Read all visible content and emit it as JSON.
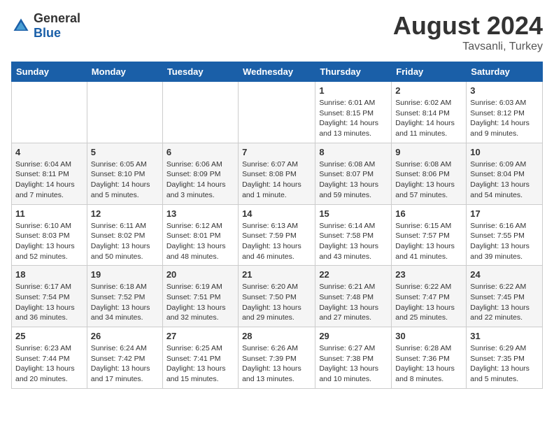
{
  "logo": {
    "text_general": "General",
    "text_blue": "Blue"
  },
  "title": "August 2024",
  "subtitle": "Tavsanli, Turkey",
  "days_of_week": [
    "Sunday",
    "Monday",
    "Tuesday",
    "Wednesday",
    "Thursday",
    "Friday",
    "Saturday"
  ],
  "weeks": [
    [
      {
        "day": "",
        "info": ""
      },
      {
        "day": "",
        "info": ""
      },
      {
        "day": "",
        "info": ""
      },
      {
        "day": "",
        "info": ""
      },
      {
        "day": "1",
        "info": "Sunrise: 6:01 AM\nSunset: 8:15 PM\nDaylight: 14 hours\nand 13 minutes."
      },
      {
        "day": "2",
        "info": "Sunrise: 6:02 AM\nSunset: 8:14 PM\nDaylight: 14 hours\nand 11 minutes."
      },
      {
        "day": "3",
        "info": "Sunrise: 6:03 AM\nSunset: 8:12 PM\nDaylight: 14 hours\nand 9 minutes."
      }
    ],
    [
      {
        "day": "4",
        "info": "Sunrise: 6:04 AM\nSunset: 8:11 PM\nDaylight: 14 hours\nand 7 minutes."
      },
      {
        "day": "5",
        "info": "Sunrise: 6:05 AM\nSunset: 8:10 PM\nDaylight: 14 hours\nand 5 minutes."
      },
      {
        "day": "6",
        "info": "Sunrise: 6:06 AM\nSunset: 8:09 PM\nDaylight: 14 hours\nand 3 minutes."
      },
      {
        "day": "7",
        "info": "Sunrise: 6:07 AM\nSunset: 8:08 PM\nDaylight: 14 hours\nand 1 minute."
      },
      {
        "day": "8",
        "info": "Sunrise: 6:08 AM\nSunset: 8:07 PM\nDaylight: 13 hours\nand 59 minutes."
      },
      {
        "day": "9",
        "info": "Sunrise: 6:08 AM\nSunset: 8:06 PM\nDaylight: 13 hours\nand 57 minutes."
      },
      {
        "day": "10",
        "info": "Sunrise: 6:09 AM\nSunset: 8:04 PM\nDaylight: 13 hours\nand 54 minutes."
      }
    ],
    [
      {
        "day": "11",
        "info": "Sunrise: 6:10 AM\nSunset: 8:03 PM\nDaylight: 13 hours\nand 52 minutes."
      },
      {
        "day": "12",
        "info": "Sunrise: 6:11 AM\nSunset: 8:02 PM\nDaylight: 13 hours\nand 50 minutes."
      },
      {
        "day": "13",
        "info": "Sunrise: 6:12 AM\nSunset: 8:01 PM\nDaylight: 13 hours\nand 48 minutes."
      },
      {
        "day": "14",
        "info": "Sunrise: 6:13 AM\nSunset: 7:59 PM\nDaylight: 13 hours\nand 46 minutes."
      },
      {
        "day": "15",
        "info": "Sunrise: 6:14 AM\nSunset: 7:58 PM\nDaylight: 13 hours\nand 43 minutes."
      },
      {
        "day": "16",
        "info": "Sunrise: 6:15 AM\nSunset: 7:57 PM\nDaylight: 13 hours\nand 41 minutes."
      },
      {
        "day": "17",
        "info": "Sunrise: 6:16 AM\nSunset: 7:55 PM\nDaylight: 13 hours\nand 39 minutes."
      }
    ],
    [
      {
        "day": "18",
        "info": "Sunrise: 6:17 AM\nSunset: 7:54 PM\nDaylight: 13 hours\nand 36 minutes."
      },
      {
        "day": "19",
        "info": "Sunrise: 6:18 AM\nSunset: 7:52 PM\nDaylight: 13 hours\nand 34 minutes."
      },
      {
        "day": "20",
        "info": "Sunrise: 6:19 AM\nSunset: 7:51 PM\nDaylight: 13 hours\nand 32 minutes."
      },
      {
        "day": "21",
        "info": "Sunrise: 6:20 AM\nSunset: 7:50 PM\nDaylight: 13 hours\nand 29 minutes."
      },
      {
        "day": "22",
        "info": "Sunrise: 6:21 AM\nSunset: 7:48 PM\nDaylight: 13 hours\nand 27 minutes."
      },
      {
        "day": "23",
        "info": "Sunrise: 6:22 AM\nSunset: 7:47 PM\nDaylight: 13 hours\nand 25 minutes."
      },
      {
        "day": "24",
        "info": "Sunrise: 6:22 AM\nSunset: 7:45 PM\nDaylight: 13 hours\nand 22 minutes."
      }
    ],
    [
      {
        "day": "25",
        "info": "Sunrise: 6:23 AM\nSunset: 7:44 PM\nDaylight: 13 hours\nand 20 minutes."
      },
      {
        "day": "26",
        "info": "Sunrise: 6:24 AM\nSunset: 7:42 PM\nDaylight: 13 hours\nand 17 minutes."
      },
      {
        "day": "27",
        "info": "Sunrise: 6:25 AM\nSunset: 7:41 PM\nDaylight: 13 hours\nand 15 minutes."
      },
      {
        "day": "28",
        "info": "Sunrise: 6:26 AM\nSunset: 7:39 PM\nDaylight: 13 hours\nand 13 minutes."
      },
      {
        "day": "29",
        "info": "Sunrise: 6:27 AM\nSunset: 7:38 PM\nDaylight: 13 hours\nand 10 minutes."
      },
      {
        "day": "30",
        "info": "Sunrise: 6:28 AM\nSunset: 7:36 PM\nDaylight: 13 hours\nand 8 minutes."
      },
      {
        "day": "31",
        "info": "Sunrise: 6:29 AM\nSunset: 7:35 PM\nDaylight: 13 hours\nand 5 minutes."
      }
    ]
  ]
}
